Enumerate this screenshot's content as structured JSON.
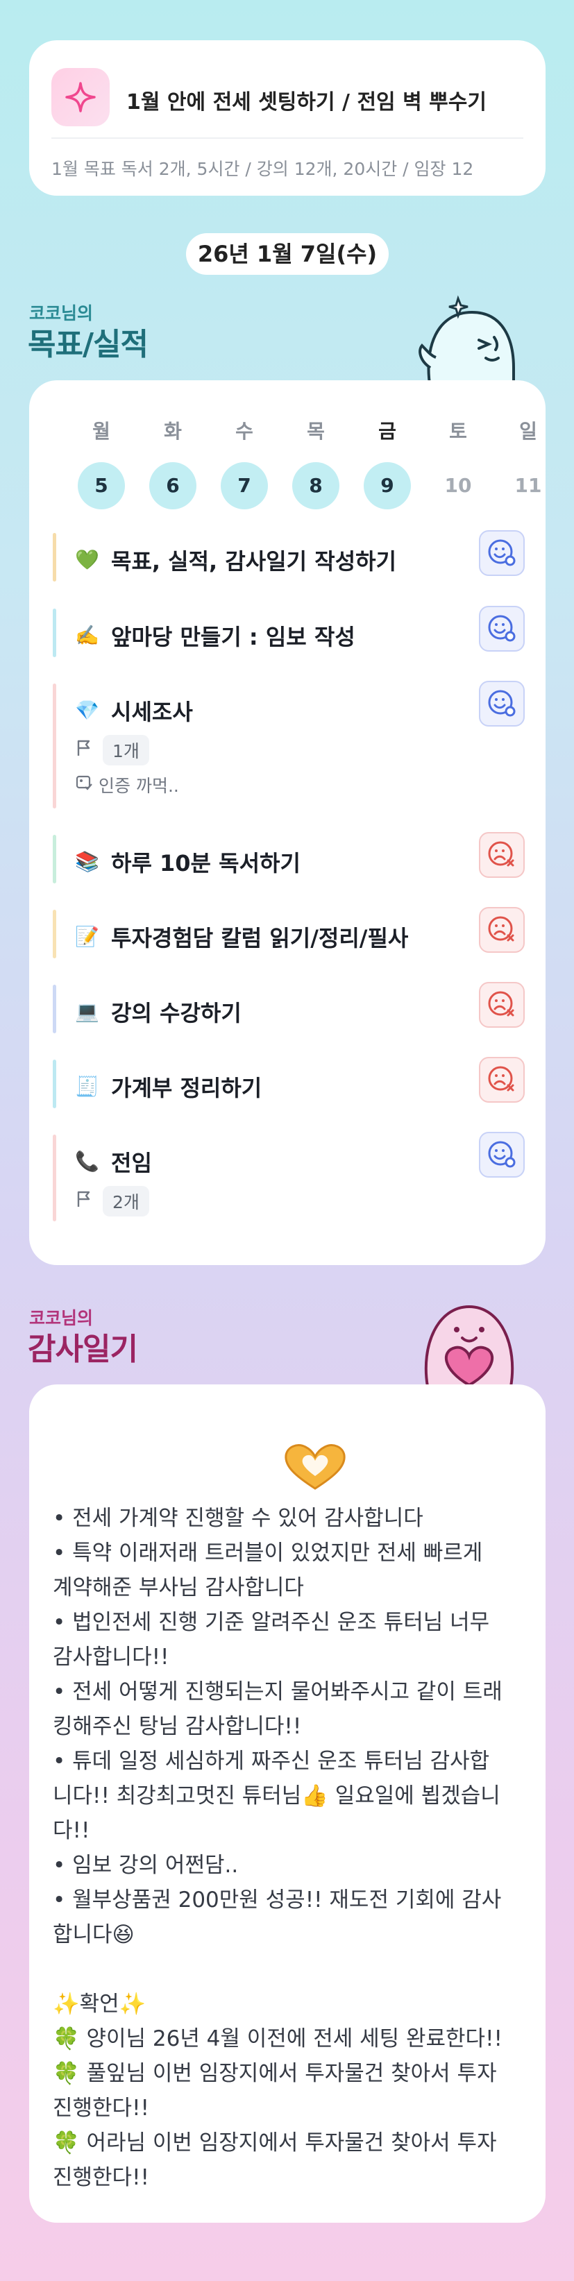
{
  "goal": {
    "icon": "sparkle-icon",
    "title": "1월 안에 전세 셋팅하기 / 전임 벽 뿌수기",
    "subtitle": "1월 목표  독서 2개, 5시간 / 강의 12개, 20시간 / 임장 12"
  },
  "date": "26년 1월 7일(수)",
  "goals_section": {
    "small": "코코님의",
    "big": "목표/실적"
  },
  "week": [
    {
      "label": "월",
      "num": "5",
      "active": true
    },
    {
      "label": "화",
      "num": "6",
      "active": true
    },
    {
      "label": "수",
      "num": "7",
      "active": true
    },
    {
      "label": "목",
      "num": "8",
      "active": true
    },
    {
      "label": "금",
      "num": "9",
      "active": true,
      "today": true
    },
    {
      "label": "토",
      "num": "10",
      "active": false
    },
    {
      "label": "일",
      "num": "11",
      "active": false
    }
  ],
  "tasks": [
    {
      "emoji": "💚",
      "title": "목표, 실적, 감사일기 작성하기",
      "status": "done",
      "bar": "#f6dcaa"
    },
    {
      "emoji": "✍️",
      "title": "앞마당 만들기 : 임보 작성",
      "status": "done",
      "bar": "#bde9f2"
    },
    {
      "emoji": "💎",
      "title": "시세조사",
      "status": "done",
      "bar": "#f9d6d6",
      "count": "1개",
      "note": "인증 까먹.."
    },
    {
      "emoji": "📚",
      "title": "하루 10분 독서하기",
      "status": "failed",
      "bar": "#c8eedc"
    },
    {
      "emoji": "📝",
      "title": "투자경험담 칼럼 읽기/정리/필사",
      "status": "failed",
      "bar": "#f8e2b4"
    },
    {
      "emoji": "💻",
      "title": "강의 수강하기",
      "status": "failed",
      "bar": "#cdd9f5"
    },
    {
      "emoji": "🧾",
      "title": "가계부 정리하기",
      "status": "failed",
      "bar": "#bde9f2"
    },
    {
      "emoji": "📞",
      "title": "전임",
      "status": "done",
      "bar": "#f9d6d6",
      "count": "2개"
    }
  ],
  "gratitude_section": {
    "small": "코코님의",
    "big": "감사일기"
  },
  "gratitude": {
    "icon": "heart-hands-icon",
    "lines": [
      "• 전세 가계약 진행할 수 있어 감사합니다",
      "• 특약 이래저래 트러블이 있었지만 전세 빠르게",
      "계약해준 부사님 감사합니다",
      "• 법인전세 진행 기준 알려주신 운조 튜터님 너무",
      "감사합니다!!",
      "• 전세 어떻게 진행되는지 물어봐주시고 같이 트래",
      "킹해주신 탕님 감사합니다!!",
      "• 튜데 일정 세심하게 짜주신 운조 튜터님 감사합",
      "니다!! 최강최고멋진 튜터님👍 일요일에 뵙겠습니",
      "다!!",
      "• 임보 강의 어쩐담..",
      "• 월부상품권 200만원 성공!! 재도전 기회에 감사",
      "합니다😆",
      "",
      "✨확언✨",
      "🍀 양이님 26년 4월 이전에 전세 세팅 완료한다!!",
      "🍀 풀잎님 이번 임장지에서 투자물건 찾아서 투자",
      "진행한다!!",
      "🍀 어라님 이번 임장지에서 투자물건 찾아서 투자",
      "진행한다!!"
    ]
  },
  "colors": {
    "active_day": "#c2eef3",
    "goals_heading": "#1f6f7a",
    "gratitude_heading": "#9b2462"
  }
}
